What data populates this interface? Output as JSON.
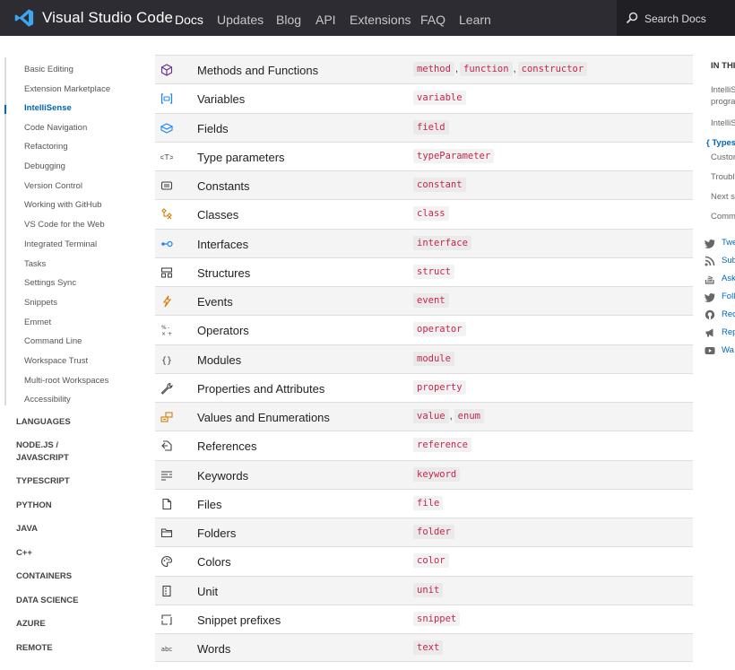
{
  "header": {
    "brand": "Visual Studio Code",
    "nav": [
      "Docs",
      "Updates",
      "Blog",
      "API",
      "Extensions",
      "FAQ",
      "Learn"
    ],
    "active_nav": "Docs",
    "search_placeholder": "Search Docs"
  },
  "sidebar": {
    "items": [
      "Basic Editing",
      "Extension Marketplace",
      "IntelliSense",
      "Code Navigation",
      "Refactoring",
      "Debugging",
      "Version Control",
      "Working with GitHub",
      "VS Code for the Web",
      "Integrated Terminal",
      "Tasks",
      "Settings Sync",
      "Snippets",
      "Emmet",
      "Command Line",
      "Workspace Trust",
      "Multi-root Workspaces",
      "Accessibility"
    ],
    "active_item": "IntelliSense",
    "categories": [
      "LANGUAGES",
      "NODE.JS / JAVASCRIPT",
      "TYPESCRIPT",
      "PYTHON",
      "JAVA",
      "C++",
      "CONTAINERS",
      "DATA SCIENCE",
      "AZURE",
      "REMOTE"
    ]
  },
  "types": [
    {
      "icon": "cube-icon",
      "name": "Methods and Functions",
      "codes": [
        "method",
        "function",
        "constructor"
      ],
      "color": "#652d90"
    },
    {
      "icon": "variable-icon",
      "name": "Variables",
      "codes": [
        "variable"
      ],
      "color": "#1a85ff"
    },
    {
      "icon": "field-icon",
      "name": "Fields",
      "codes": [
        "field"
      ],
      "color": "#1a85ff"
    },
    {
      "icon": "type-parameter-icon",
      "name": "Type parameters",
      "codes": [
        "typeParameter"
      ],
      "color": "#424242"
    },
    {
      "icon": "constant-icon",
      "name": "Constants",
      "codes": [
        "constant"
      ],
      "color": "#424242"
    },
    {
      "icon": "class-icon",
      "name": "Classes",
      "codes": [
        "class"
      ],
      "color": "#d67e00"
    },
    {
      "icon": "interface-icon",
      "name": "Interfaces",
      "codes": [
        "interface"
      ],
      "color": "#1a85ff"
    },
    {
      "icon": "structure-icon",
      "name": "Structures",
      "codes": [
        "struct"
      ],
      "color": "#424242"
    },
    {
      "icon": "event-icon",
      "name": "Events",
      "codes": [
        "event"
      ],
      "color": "#d67e00"
    },
    {
      "icon": "operator-icon",
      "name": "Operators",
      "codes": [
        "operator"
      ],
      "color": "#424242"
    },
    {
      "icon": "module-icon",
      "name": "Modules",
      "codes": [
        "module"
      ],
      "color": "#424242"
    },
    {
      "icon": "wrench-icon",
      "name": "Properties and Attributes",
      "codes": [
        "property"
      ],
      "color": "#424242"
    },
    {
      "icon": "enum-icon",
      "name": "Values and Enumerations",
      "codes": [
        "value",
        "enum"
      ],
      "color": "#d67e00"
    },
    {
      "icon": "reference-icon",
      "name": "References",
      "codes": [
        "reference"
      ],
      "color": "#424242"
    },
    {
      "icon": "keyword-icon",
      "name": "Keywords",
      "codes": [
        "keyword"
      ],
      "color": "#424242"
    },
    {
      "icon": "file-icon",
      "name": "Files",
      "codes": [
        "file"
      ],
      "color": "#424242"
    },
    {
      "icon": "folder-icon",
      "name": "Folders",
      "codes": [
        "folder"
      ],
      "color": "#424242"
    },
    {
      "icon": "palette-icon",
      "name": "Colors",
      "codes": [
        "color"
      ],
      "color": "#424242"
    },
    {
      "icon": "unit-icon",
      "name": "Unit",
      "codes": [
        "unit"
      ],
      "color": "#424242"
    },
    {
      "icon": "snippet-icon",
      "name": "Snippet prefixes",
      "codes": [
        "snippet"
      ],
      "color": "#424242"
    },
    {
      "icon": "text-icon",
      "name": "Words",
      "codes": [
        "text"
      ],
      "color": "#424242"
    }
  ],
  "toc": {
    "heading": "IN THI",
    "items": [
      "IntelliS progra",
      "IntelliS",
      "{ Types",
      "Custor",
      "Troubl",
      "Next s",
      "Comm"
    ],
    "active_item": "{ Types",
    "links": [
      {
        "icon": "twitter-icon",
        "label": "Twe"
      },
      {
        "icon": "rss-icon",
        "label": "Sub"
      },
      {
        "icon": "stack-icon",
        "label": "Ask"
      },
      {
        "icon": "twitter-icon",
        "label": "Foll"
      },
      {
        "icon": "github-icon",
        "label": "Rec"
      },
      {
        "icon": "megaphone-icon",
        "label": "Rep"
      },
      {
        "icon": "youtube-icon",
        "label": "Wa"
      }
    ]
  },
  "colors": {
    "accent": "#0066b8",
    "header_bg": "#2c2c32",
    "code_text": "#c7254e"
  }
}
